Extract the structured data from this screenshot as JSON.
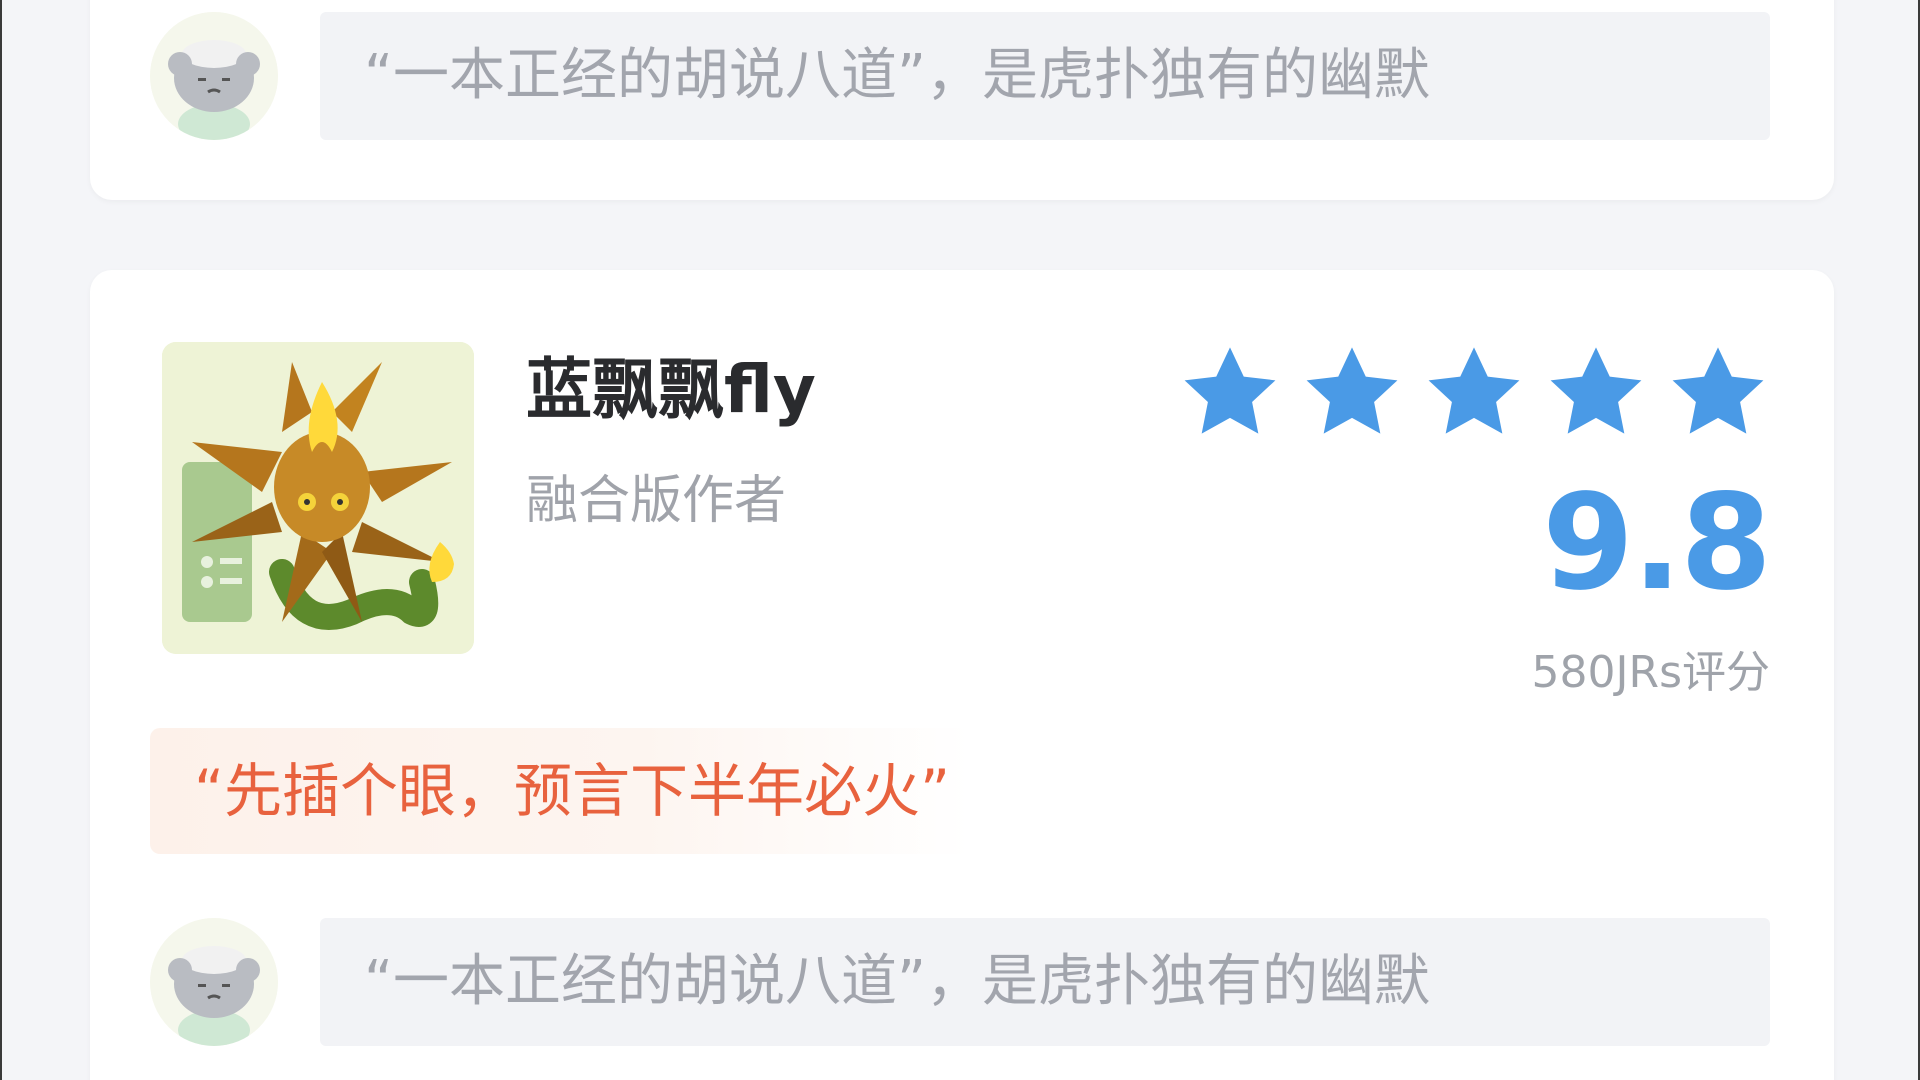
{
  "top_card": {
    "comment": {
      "avatar_icon": "cat-avatar-icon",
      "text": "“一本正经的胡说八道”，是虎扑独有的幽默"
    }
  },
  "main_card": {
    "app": {
      "icon": "fire-lotus-plant-icon",
      "name": "蓝飘飘fly",
      "subtitle": "融合版作者"
    },
    "rating": {
      "stars": 5,
      "star_color": "#4a9ae6",
      "score": "9.8",
      "count_label": "580JRs评分"
    },
    "quote": {
      "text": "“先插个眼，预言下半年必火”",
      "color": "#e8623e"
    },
    "comment": {
      "avatar_icon": "cat-avatar-icon",
      "text": "“一本正经的胡说八道”，是虎扑独有的幽默"
    }
  }
}
